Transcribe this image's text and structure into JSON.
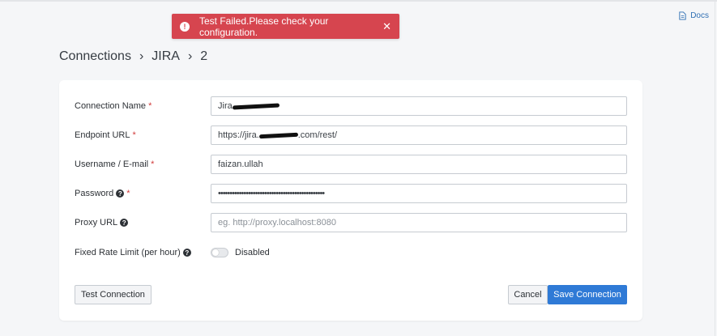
{
  "header": {
    "docs_label": "Docs",
    "docs_icon": "document-icon"
  },
  "toast": {
    "message": "Test Failed.Please check your configuration.",
    "icon": "alert-icon",
    "close": "✕",
    "color": "#d6454f"
  },
  "breadcrumb": {
    "items": [
      "Connections",
      "JIRA",
      "2"
    ],
    "separator": "›"
  },
  "form": {
    "connection_name": {
      "label": "Connection Name",
      "required": "*",
      "value": "Jira"
    },
    "endpoint_url": {
      "label": "Endpoint URL",
      "required": "*",
      "value_prefix": "https://jira.",
      "value_suffix": ".com/rest/"
    },
    "username": {
      "label": "Username / E-mail",
      "required": "*",
      "value": "faizan.ullah"
    },
    "password": {
      "label": "Password",
      "required": "*",
      "help": "?",
      "value": "••••••••••••••••••••••••••••••••••••••••••••••"
    },
    "proxy_url": {
      "label": "Proxy URL",
      "help": "?",
      "placeholder": "eg. http://proxy.localhost:8080"
    },
    "rate_limit": {
      "label": "Fixed Rate Limit (per hour)",
      "help": "?",
      "toggle_state": "Disabled"
    }
  },
  "actions": {
    "test_label": "Test Connection",
    "cancel_label": "Cancel",
    "save_label": "Save Connection",
    "primary_color": "#2f7ad6"
  }
}
